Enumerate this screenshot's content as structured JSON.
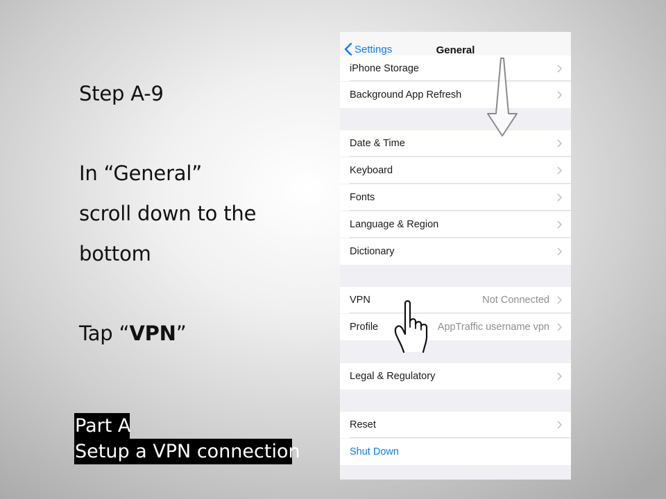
{
  "slide": {
    "step_title": "Step A-9",
    "instruction_line1": "In “General”",
    "instruction_line2": "scroll down to the",
    "instruction_line3": "bottom",
    "tap_prefix": "Tap “",
    "tap_target": "VPN",
    "tap_suffix": "”",
    "part_label": "Part A",
    "part_subtitle": "Setup a VPN connection"
  },
  "phone": {
    "back_label": "Settings",
    "title": "General",
    "rows": {
      "iphone_storage": {
        "label": "iPhone Storage"
      },
      "background_app_refresh": {
        "label": "Background App Refresh"
      },
      "date_time": {
        "label": "Date & Time"
      },
      "keyboard": {
        "label": "Keyboard"
      },
      "fonts": {
        "label": "Fonts"
      },
      "language_region": {
        "label": "Language & Region"
      },
      "dictionary": {
        "label": "Dictionary"
      },
      "vpn": {
        "label": "VPN",
        "value": "Not Connected"
      },
      "profile": {
        "label": "Profile",
        "value": "AppTraffic username vpn"
      },
      "legal": {
        "label": "Legal & Regulatory"
      },
      "reset": {
        "label": "Reset"
      },
      "shut_down": {
        "label": "Shut Down"
      }
    }
  },
  "colors": {
    "accent": "#0a7aff",
    "secondary_text": "#8e8e93",
    "group_background": "#efeff4"
  },
  "icons": [
    "chevron-left-icon",
    "chevron-right-icon",
    "scroll-down-arrow-icon",
    "tap-hand-icon"
  ]
}
